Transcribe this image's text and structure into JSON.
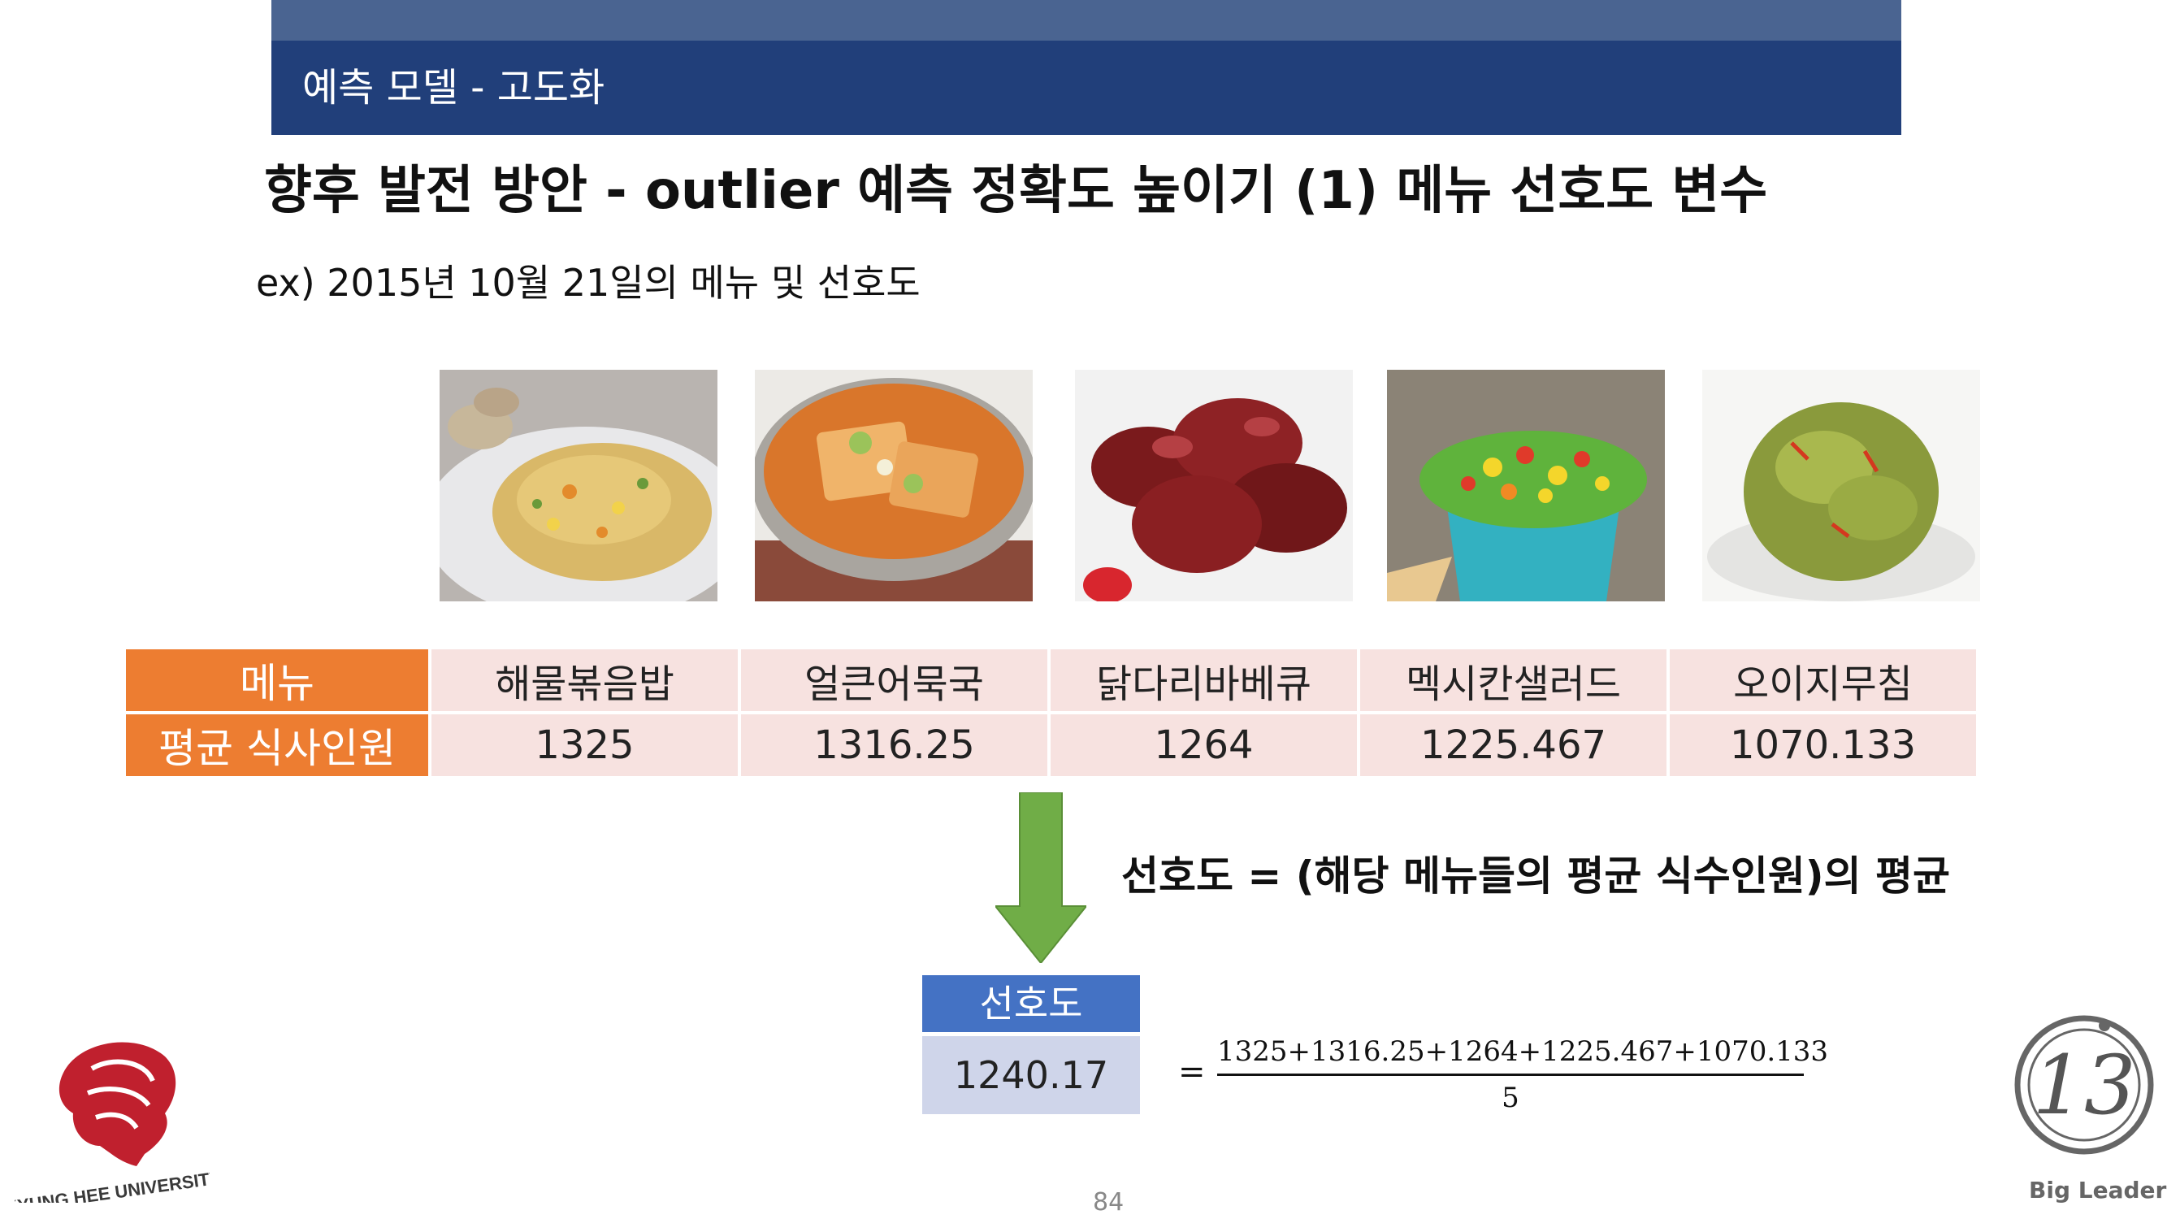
{
  "header": {
    "section": "예측 모델 - 고도화"
  },
  "title": "향후 발전 방안 - outlier 예측 정확도 높이기 (1) 메뉴 선호도 변수",
  "subtitle": "ex) 2015년 10월 21일의 메뉴 및 선호도",
  "table": {
    "row1_header": "메뉴",
    "row2_header": "평균 식사인원",
    "menus": [
      "해물볶음밥",
      "얼큰어묵국",
      "닭다리바베큐",
      "멕시칸샐러드",
      "오이지무침"
    ],
    "values": [
      "1325",
      "1316.25",
      "1264",
      "1225.467",
      "1070.133"
    ]
  },
  "formula_text": "선호도 = (해당 메뉴들의 평균 식수인원)의 평균",
  "preference": {
    "label": "선호도",
    "value": "1240.17"
  },
  "equation": {
    "equals": "=",
    "numerator": "1325+1316.25+1264+1225.467+1070.133",
    "denominator": "5"
  },
  "logos": {
    "university": "KYUNG HEE UNIVERSITY",
    "brand": "Big Leader"
  },
  "page_number": "84",
  "colors": {
    "header_dark": "#213f7a",
    "header_light": "#4a6491",
    "table_head": "#ed7d31",
    "table_cell": "#f7e2e0",
    "arrow": "#70ad47",
    "pref_head": "#4472c4",
    "pref_value": "#cfd5ea",
    "khu_red": "#c0202e"
  },
  "icons": [
    "fried-rice-photo",
    "fishcake-soup-photo",
    "bbq-drumstick-photo",
    "mexican-salad-photo",
    "pickled-cucumber-photo",
    "down-arrow-icon",
    "khu-lion-logo",
    "big-leader-logo"
  ]
}
